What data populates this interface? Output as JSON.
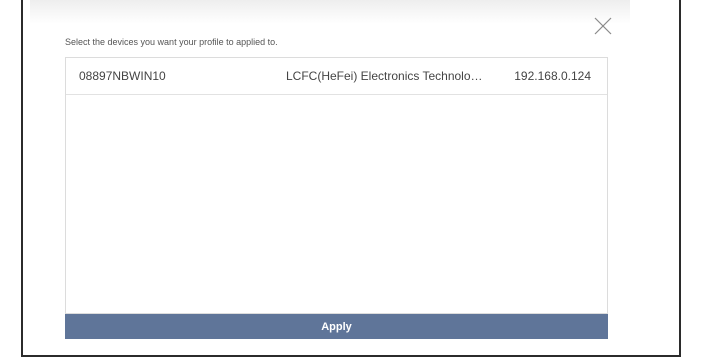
{
  "dialog": {
    "instruction": "Select the devices you want your profile to applied to.",
    "close_icon": "close-icon"
  },
  "devices": [
    {
      "name": "08897NBWIN10",
      "vendor": "LCFC(HeFei) Electronics Technolo…",
      "ip": "192.168.0.124"
    }
  ],
  "apply_label": "Apply",
  "colors": {
    "apply_bg": "#5f7599",
    "text": "#444444"
  }
}
